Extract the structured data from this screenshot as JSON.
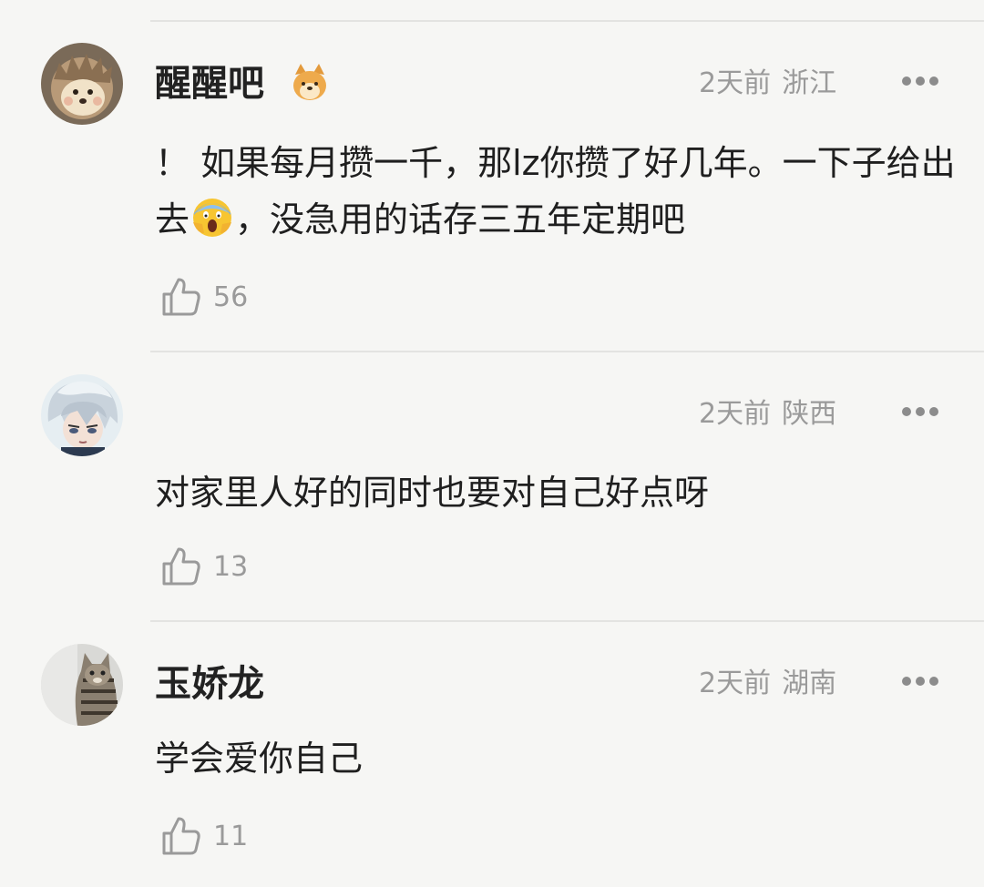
{
  "comments": [
    {
      "username": "醒醒吧",
      "avatar_icon": "hedgehog-avatar",
      "badge_icon": "shiba-dog-emoji",
      "time": "2天前",
      "location": "浙江",
      "text_part1": "！ 如果每月攒一千，那lz你攒了好几年。一下子给出去",
      "emoji_icon": "screaming-face-emoji",
      "text_part2": "，没急用的话存三五年定期吧",
      "likes": "56"
    },
    {
      "username": "",
      "avatar_icon": "anime-boy-avatar",
      "time": "2天前",
      "location": "陕西",
      "text": "对家里人好的同时也要对自己好点呀",
      "likes": "13"
    },
    {
      "username": "玉娇龙",
      "avatar_icon": "tabby-cat-avatar",
      "time": "2天前",
      "location": "湖南",
      "text": "学会爱你自己",
      "likes": "11"
    }
  ],
  "icons": {
    "like": "thumbs-up-icon",
    "more": "more-dots-icon"
  },
  "colors": {
    "background": "#f6f6f4",
    "text_primary": "#1f1f1f",
    "text_secondary": "#9a9a9a",
    "divider": "#e3e3e1"
  }
}
